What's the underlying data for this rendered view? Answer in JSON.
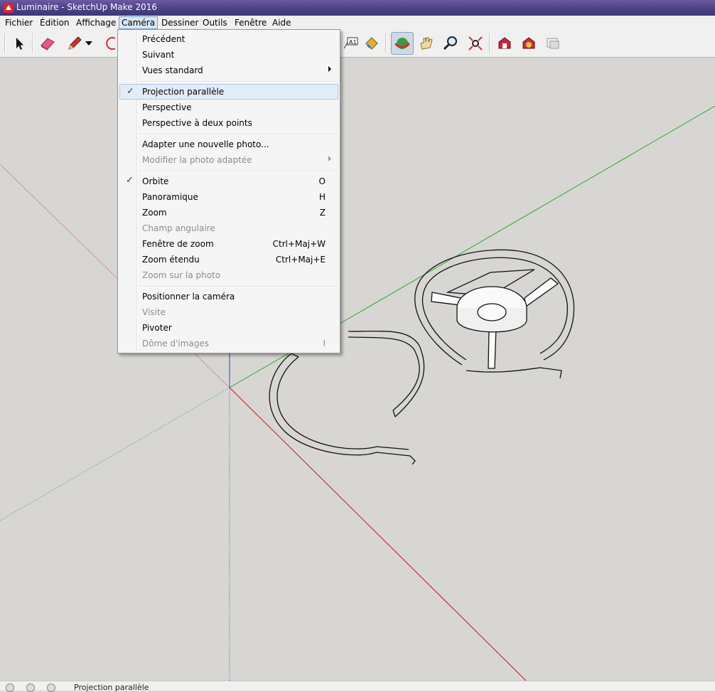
{
  "window": {
    "title": "Luminaire - SketchUp Make 2016"
  },
  "menubar": {
    "items": [
      {
        "label": "Fichier"
      },
      {
        "label": "Édition"
      },
      {
        "label": "Affichage"
      },
      {
        "label": "Caméra",
        "active": true
      },
      {
        "label": "Dessiner"
      },
      {
        "label": "Outils"
      },
      {
        "label": "Fenêtre"
      },
      {
        "label": "Aide"
      }
    ]
  },
  "toolbar": {
    "buttons": [
      {
        "icon": "select-arrow-icon"
      },
      {
        "icon": "eraser-icon"
      },
      {
        "icon": "pencil-line-icon"
      },
      {
        "icon": "dropdown-arrow-icon"
      },
      {
        "icon": "arc-icon"
      },
      {
        "icon": "text-label-icon"
      },
      {
        "icon": "paint-bucket-icon"
      },
      {
        "icon": "orbit-icon",
        "pressed": true
      },
      {
        "icon": "pan-hand-icon"
      },
      {
        "icon": "zoom-magnifier-icon"
      },
      {
        "icon": "zoom-extents-icon"
      },
      {
        "icon": "warehouse-icon"
      },
      {
        "icon": "extension-warehouse-icon"
      },
      {
        "icon": "send-to-layout-icon"
      }
    ]
  },
  "camera_menu": {
    "items": [
      {
        "label": "Précédent",
        "shortcut": "",
        "checked": false,
        "submenu": false,
        "disabled": false
      },
      {
        "label": "Suivant",
        "shortcut": "",
        "checked": false,
        "submenu": false,
        "disabled": false
      },
      {
        "label": "Vues standard",
        "shortcut": "",
        "checked": false,
        "submenu": true,
        "disabled": false
      },
      {
        "separator": true
      },
      {
        "label": "Projection parallèle",
        "shortcut": "",
        "checked": true,
        "submenu": false,
        "disabled": false,
        "highlighted": true
      },
      {
        "label": "Perspective",
        "shortcut": "",
        "checked": false,
        "submenu": false,
        "disabled": false
      },
      {
        "label": "Perspective à deux points",
        "shortcut": "",
        "checked": false,
        "submenu": false,
        "disabled": false
      },
      {
        "separator": true
      },
      {
        "label": "Adapter une nouvelle photo...",
        "shortcut": "",
        "checked": false,
        "submenu": false,
        "disabled": false
      },
      {
        "label": "Modifier la photo adaptée",
        "shortcut": "",
        "checked": false,
        "submenu": true,
        "disabled": true
      },
      {
        "separator": true
      },
      {
        "label": "Orbite",
        "shortcut": "O",
        "checked": true,
        "submenu": false,
        "disabled": false
      },
      {
        "label": "Panoramique",
        "shortcut": "H",
        "checked": false,
        "submenu": false,
        "disabled": false
      },
      {
        "label": "Zoom",
        "shortcut": "Z",
        "checked": false,
        "submenu": false,
        "disabled": false
      },
      {
        "label": "Champ angulaire",
        "shortcut": "",
        "checked": false,
        "submenu": false,
        "disabled": true
      },
      {
        "label": "Fenêtre de zoom",
        "shortcut": "Ctrl+Maj+W",
        "checked": false,
        "submenu": false,
        "disabled": false
      },
      {
        "label": "Zoom étendu",
        "shortcut": "Ctrl+Maj+E",
        "checked": false,
        "submenu": false,
        "disabled": false
      },
      {
        "label": "Zoom sur la photo",
        "shortcut": "",
        "checked": false,
        "submenu": false,
        "disabled": true
      },
      {
        "separator": true
      },
      {
        "label": "Positionner la caméra",
        "shortcut": "",
        "checked": false,
        "submenu": false,
        "disabled": false
      },
      {
        "label": "Visite",
        "shortcut": "",
        "checked": false,
        "submenu": false,
        "disabled": true
      },
      {
        "label": "Pivoter",
        "shortcut": "",
        "checked": false,
        "submenu": false,
        "disabled": false
      },
      {
        "label": "Dôme d'images",
        "shortcut": "I",
        "checked": false,
        "submenu": false,
        "disabled": true
      }
    ]
  },
  "statusbar": {
    "text": "Projection parallèle"
  },
  "colors": {
    "axis_red": "#c0191c",
    "axis_green": "#2fa82f",
    "axis_blue": "#3b3bd8",
    "viewport_bg": "#d8d6d2",
    "menu_highlight": "#e3edf7",
    "title_bar": "#4b3f86"
  }
}
